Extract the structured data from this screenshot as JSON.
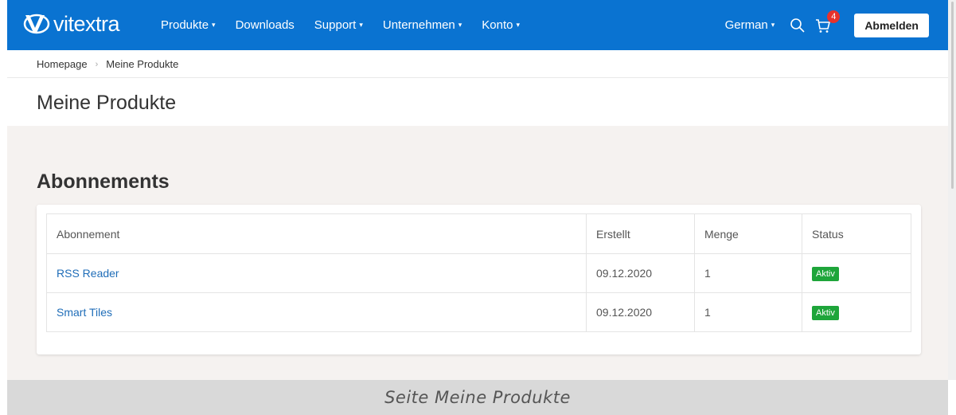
{
  "navbar": {
    "brand": "vitextra",
    "items": [
      {
        "label": "Produkte",
        "dropdown": true
      },
      {
        "label": "Downloads",
        "dropdown": false
      },
      {
        "label": "Support",
        "dropdown": true
      },
      {
        "label": "Unternehmen",
        "dropdown": true
      },
      {
        "label": "Konto",
        "dropdown": true
      }
    ],
    "language": "German",
    "cart_count": "4",
    "logout_label": "Abmelden",
    "icons": [
      "search-icon",
      "cart-icon"
    ],
    "color": "#0a73d1"
  },
  "breadcrumb": {
    "home": "Homepage",
    "current": "Meine Produkte"
  },
  "page_title": "Meine Produkte",
  "section_title": "Abonnements",
  "table": {
    "headers": [
      "Abonnement",
      "Erstellt",
      "Menge",
      "Status"
    ],
    "rows": [
      {
        "name": "RSS Reader",
        "created": "09.12.2020",
        "qty": "1",
        "status": "Aktiv"
      },
      {
        "name": "Smart Tiles",
        "created": "09.12.2020",
        "qty": "1",
        "status": "Aktiv"
      }
    ],
    "status_color": "#1ea53a"
  },
  "caption": "Seite Meine Produkte"
}
